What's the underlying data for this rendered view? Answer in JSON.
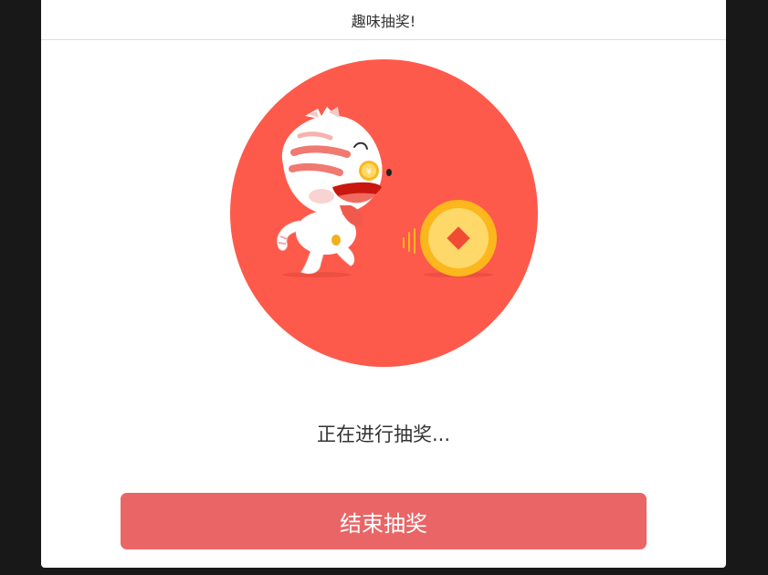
{
  "dialog": {
    "title": "趣味抽奖!"
  },
  "illustration": {
    "icon_name": "cat-chasing-coin-icon",
    "colors": {
      "circle": "#fe5a4b",
      "coin_outer": "#fcb71c",
      "coin_inner": "#ffd86a",
      "coin_mark": "#f24b35"
    },
    "coin_symbol": "¥"
  },
  "status": {
    "text": "正在进行抽奖..."
  },
  "actions": {
    "end_label": "结束抽奖",
    "button_color": "#e96566"
  }
}
